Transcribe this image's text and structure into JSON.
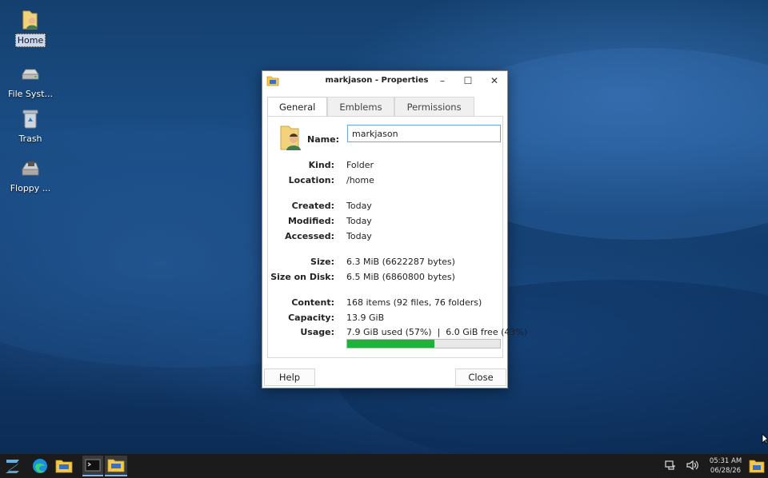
{
  "desktop": {
    "icons": [
      {
        "label": "Home",
        "icon": "home-folder-icon",
        "selected": true
      },
      {
        "label": "File Syst...",
        "icon": "drive-icon"
      },
      {
        "label": "Trash",
        "icon": "trash-icon"
      },
      {
        "label": "Floppy ...",
        "icon": "floppy-icon"
      }
    ]
  },
  "dialog": {
    "title": "markjason - Properties",
    "tabs": [
      "General",
      "Emblems",
      "Permissions"
    ],
    "name_label": "Name:",
    "name_value": "markjason",
    "fields": {
      "kind": {
        "k": "Kind:",
        "v": "Folder"
      },
      "location": {
        "k": "Location:",
        "v": "/home"
      },
      "created": {
        "k": "Created:",
        "v": "Today"
      },
      "modified": {
        "k": "Modified:",
        "v": "Today"
      },
      "accessed": {
        "k": "Accessed:",
        "v": "Today"
      },
      "size": {
        "k": "Size:",
        "v": "6.3 MiB (6622287 bytes)"
      },
      "size_on_disk": {
        "k": "Size on Disk:",
        "v": "6.5 MiB (6860800 bytes)"
      },
      "content": {
        "k": "Content:",
        "v": "168 items (92 files, 76 folders)"
      },
      "capacity": {
        "k": "Capacity:",
        "v": "13.9 GiB"
      },
      "usage": {
        "k": "Usage:",
        "v": "7.9 GiB used (57%)  |  6.0 GiB free (43%)"
      }
    },
    "usage_percent": 57,
    "help_label": "Help",
    "close_label": "Close"
  },
  "taskbar": {
    "clock_time": "05:31 AM",
    "clock_date": "06/28/26"
  },
  "colors": {
    "usage_fill": "#1fb23a",
    "input_focus": "#6aa6e0",
    "taskbar": "#1b1b1b"
  }
}
